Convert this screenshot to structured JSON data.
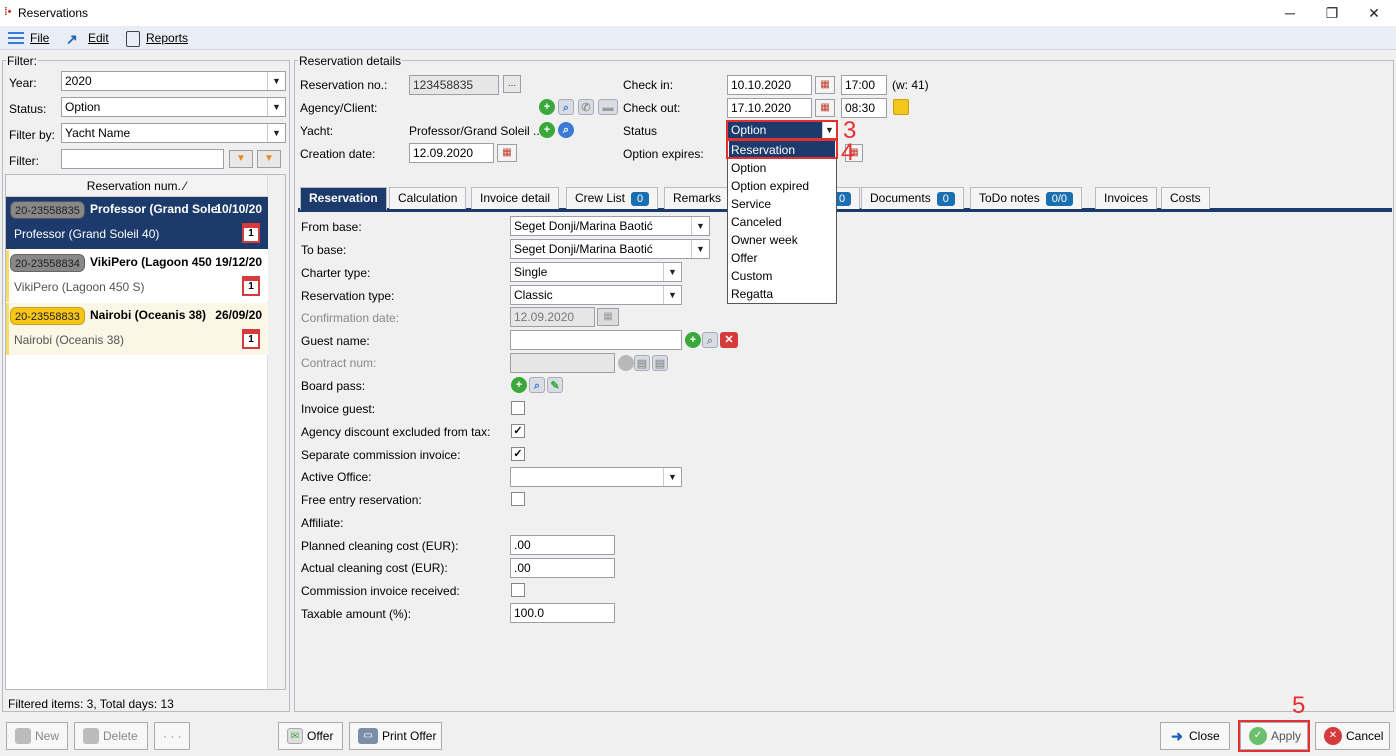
{
  "window": {
    "title": "Reservations",
    "min": "─",
    "max": "❐",
    "close": "✕"
  },
  "menu": {
    "file": "File",
    "edit": "Edit",
    "reports": "Reports"
  },
  "filter": {
    "label": "Filter:",
    "year_label": "Year:",
    "year": "2020",
    "status_label": "Status:",
    "status": "Option",
    "filterby_label": "Filter by:",
    "filterby": "Yacht Name",
    "filter_label": "Filter:",
    "filter_value": "",
    "column": "Reservation num. ⁄",
    "items": [
      {
        "badge": "20-23558835",
        "title": "Professor (Grand Solei",
        "date": "10/10/20",
        "sub": "Professor (Grand Soleil 40)"
      },
      {
        "badge": "20-23558834",
        "title": "VikiPero (Lagoon 450",
        "date": "19/12/20",
        "sub": "VikiPero (Lagoon 450 S)"
      },
      {
        "badge": "20-23558833",
        "title": "Nairobi (Oceanis 38)",
        "date": "26/09/20",
        "sub": "Nairobi (Oceanis 38)"
      }
    ],
    "cal_day": "1",
    "summary": "Filtered items: 3,  Total days: 13"
  },
  "details": {
    "label": "Reservation details",
    "resno_label": "Reservation no.:",
    "resno": "123458835",
    "more": "...",
    "agency_label": "Agency/Client:",
    "yacht_label": "Yacht:",
    "yacht": "Professor/Grand Soleil ...",
    "creation_label": "Creation date:",
    "creation": "12.09.2020",
    "checkin_label": "Check in:",
    "checkin": "10.10.2020",
    "checkin_time": "17:00",
    "week": "(w: 41)",
    "checkout_label": "Check out:",
    "checkout": "17.10.2020",
    "checkout_time": "08:30",
    "status_label": "Status",
    "status": "Option",
    "optexp_label": "Option expires:"
  },
  "tabs": [
    {
      "label": "Reservation"
    },
    {
      "label": "Calculation"
    },
    {
      "label": "Invoice detail"
    },
    {
      "label": "Crew List",
      "count": "0"
    },
    {
      "label": "Remarks"
    },
    {
      "label": "",
      "count": "0"
    },
    {
      "label": "Documents",
      "count": "0"
    },
    {
      "label": "ToDo notes",
      "count": "0/0"
    },
    {
      "label": "Invoices"
    },
    {
      "label": "Costs"
    }
  ],
  "form": {
    "from_base_label": "From base:",
    "from_base": "Seget Donji/Marina Baotić",
    "to_base_label": "To base:",
    "to_base": "Seget Donji/Marina Baotić",
    "charter_label": "Charter type:",
    "charter": "Single",
    "restype_label": "Reservation type:",
    "restype": "Classic",
    "confdate_label": "Confirmation date:",
    "confdate": "12.09.2020",
    "guest_label": "Guest name:",
    "contract_label": "Contract num:",
    "board_label": "Board pass:",
    "invguest_label": "Invoice guest:",
    "agency_disc_label": "Agency discount excluded from tax:",
    "sep_comm_label": "Separate commission invoice:",
    "office_label": "Active Office:",
    "free_entry_label": "Free entry reservation:",
    "affiliate_label": "Affiliate:",
    "planned_label": "Planned cleaning cost (EUR):",
    "planned": ".00",
    "actual_label": "Actual cleaning cost (EUR):",
    "actual": ".00",
    "comm_recv_label": "Commission invoice received:",
    "taxable_label": "Taxable amount (%):",
    "taxable": "100.0",
    "check": "✓"
  },
  "status_options": [
    "Reservation",
    "Option",
    "Option expired",
    "Service",
    "Canceled",
    "Owner week",
    "Offer",
    "Custom",
    "Regatta"
  ],
  "buttons": {
    "new": "New",
    "delete": "Delete",
    "more": "· · ·",
    "offer": "Offer",
    "print_offer": "Print Offer",
    "close": "Close",
    "apply": "Apply",
    "cancel": "Cancel"
  },
  "annotations": {
    "a3": "3",
    "a4": "4",
    "a5": "5"
  }
}
